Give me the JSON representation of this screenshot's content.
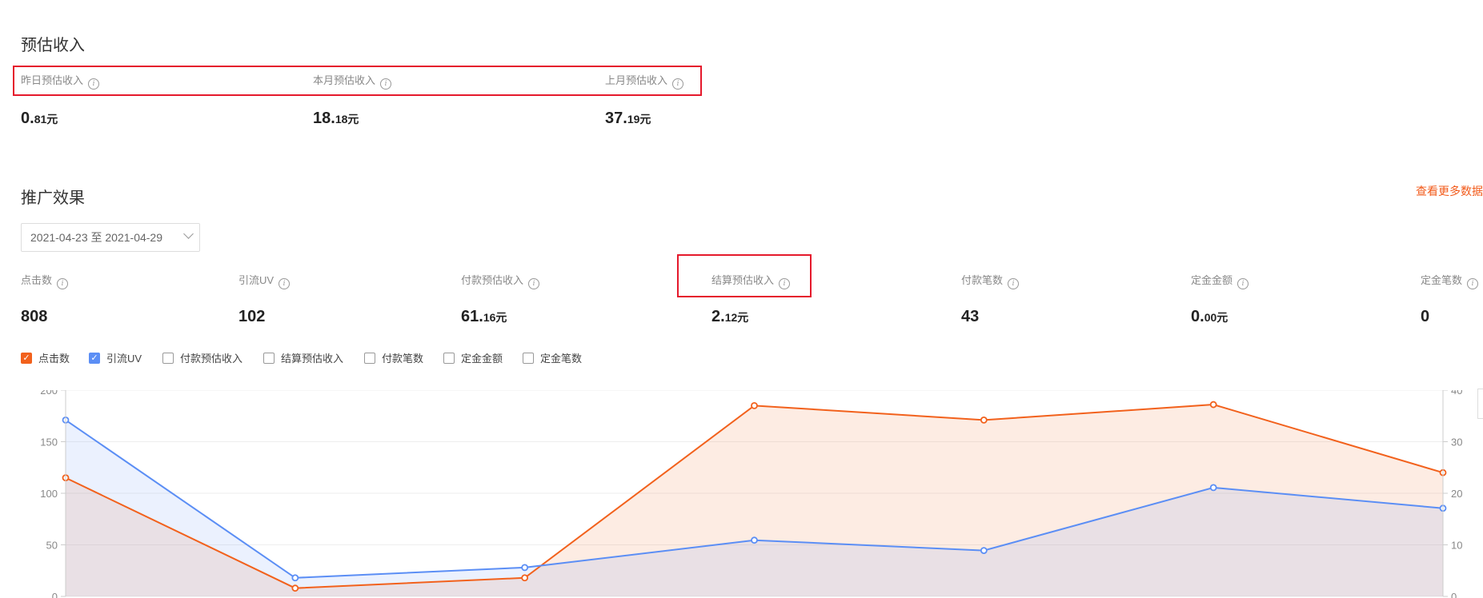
{
  "estimated_income": {
    "title": "预估收入",
    "stats": [
      {
        "label": "昨日预估收入",
        "int": "0.",
        "dec": "81元"
      },
      {
        "label": "本月预估收入",
        "int": "18.",
        "dec": "18元"
      },
      {
        "label": "上月预估收入",
        "int": "37.",
        "dec": "19元"
      }
    ]
  },
  "promotion": {
    "title": "推广效果",
    "more_link": "查看更多数据",
    "date_range": "2021-04-23 至 2021-04-29",
    "stats": [
      {
        "label": "点击数",
        "int": "808",
        "dec": ""
      },
      {
        "label": "引流UV",
        "int": "102",
        "dec": ""
      },
      {
        "label": "付款预估收入",
        "int": "61.",
        "dec": "16元"
      },
      {
        "label": "结算预估收入",
        "int": "2.",
        "dec": "12元"
      },
      {
        "label": "付款笔数",
        "int": "43",
        "dec": ""
      },
      {
        "label": "定金金额",
        "int": "0.",
        "dec": "00元"
      },
      {
        "label": "定金笔数",
        "int": "0",
        "dec": ""
      }
    ],
    "legend": [
      {
        "label": "点击数",
        "checked": true,
        "color": "#f2611c"
      },
      {
        "label": "引流UV",
        "checked": true,
        "color": "#5b8ef5"
      },
      {
        "label": "付款预估收入",
        "checked": false
      },
      {
        "label": "结算预估收入",
        "checked": false
      },
      {
        "label": "付款笔数",
        "checked": false
      },
      {
        "label": "定金金额",
        "checked": false
      },
      {
        "label": "定金笔数",
        "checked": false
      }
    ]
  },
  "chart_data": {
    "type": "area",
    "y_left_ticks": [
      "200",
      "150",
      "100",
      "50",
      "0"
    ],
    "y_right_ticks": [
      "40",
      "30",
      "20",
      "10",
      "0"
    ],
    "ylim_left": [
      0,
      200
    ],
    "ylim_right": [
      0,
      40
    ],
    "grid": true,
    "series": [
      {
        "name": "点击数",
        "axis": "left",
        "color": "#f2611c",
        "fill": "#fdeee6",
        "values": [
          115,
          8,
          18,
          185,
          171,
          186,
          120
        ]
      },
      {
        "name": "引流UV",
        "axis": "right",
        "color": "#5b8ef5",
        "fill": "#edf2fd",
        "values": [
          34.2,
          3.6,
          5.6,
          10.9,
          8.9,
          21.1,
          17.1
        ]
      }
    ]
  }
}
